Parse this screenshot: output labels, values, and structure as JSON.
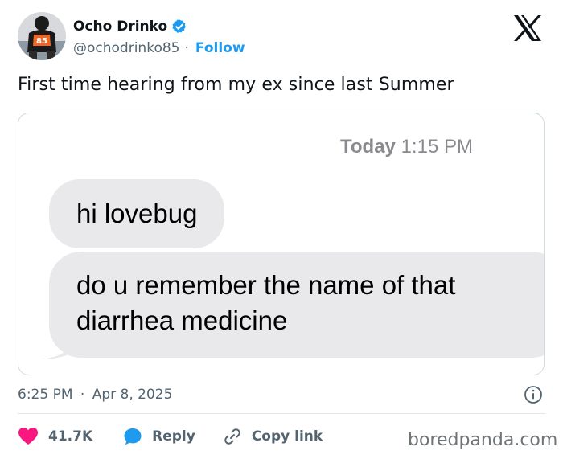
{
  "author": {
    "name": "Ocho Drinko",
    "handle": "@ochodrinko85",
    "separator": "·",
    "follow_label": "Follow",
    "jersey_number": "85",
    "verified_color": "#1d9bf0"
  },
  "tweet": {
    "text": "First time hearing from my ex since last Summer"
  },
  "screenshot": {
    "timestamp_day": "Today",
    "timestamp_time": "1:15 PM",
    "messages": [
      {
        "text": "hi lovebug"
      },
      {
        "text": "do u remember the name of that diarrhea medicine"
      }
    ]
  },
  "meta": {
    "time": "6:25 PM",
    "separator": "·",
    "date": "Apr 8, 2025"
  },
  "actions": {
    "likes": "41.7K",
    "reply_label": "Reply",
    "copy_label": "Copy link"
  },
  "watermark": "boredpanda.com",
  "colors": {
    "accent": "#1d9bf0",
    "like": "#f91880",
    "bubble": "#e9e9eb"
  },
  "icons": [
    "verified-badge-icon",
    "x-logo-icon",
    "info-icon",
    "heart-icon",
    "reply-icon",
    "link-icon"
  ]
}
